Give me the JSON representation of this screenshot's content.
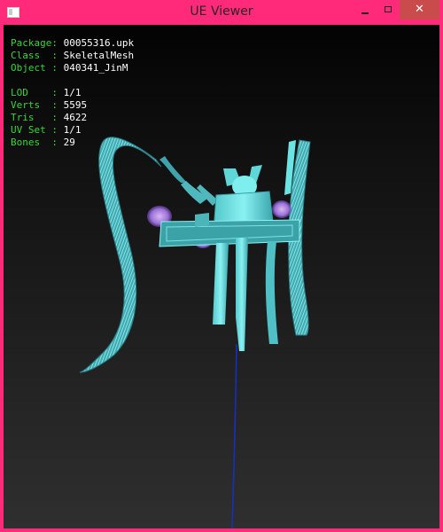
{
  "window": {
    "title": "UE Viewer",
    "minimize_label": "",
    "maximize_label": "",
    "close_label": "✕"
  },
  "info": {
    "package": {
      "label": "Package:",
      "value": "00055316.upk"
    },
    "class": {
      "label": "Class  :",
      "value": "SkeletalMesh"
    },
    "object": {
      "label": "Object :",
      "value": "040341_JinM"
    },
    "lod": {
      "label": "LOD    :",
      "value": "1/1"
    },
    "verts": {
      "label": "Verts  :",
      "value": "5595"
    },
    "tris": {
      "label": "Tris   :",
      "value": "4622"
    },
    "uvset": {
      "label": "UV Set :",
      "value": "1/1"
    },
    "bones": {
      "label": "Bones  :",
      "value": "29"
    }
  },
  "colors": {
    "window_border": "#ff2a79",
    "label_green": "#38d538",
    "mesh_cyan": "#6ce4e4",
    "mesh_dark": "#2f8c93",
    "bone_blue": "#1830b8",
    "purple": "#8a4dc0"
  }
}
